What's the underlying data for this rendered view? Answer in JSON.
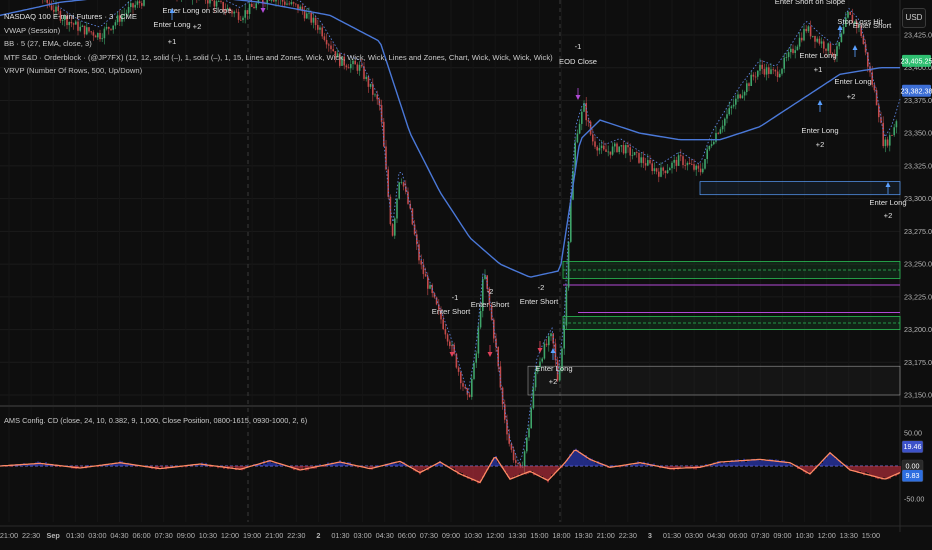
{
  "legend": {
    "symbol": "NASDAQ 100 E-mini Futures · 3 · CME",
    "lines": [
      "VWAP (Session)",
      "BB · 5 (27, EMA, close, 3)",
      "MTF S&D · Orderblock · (@JP7FX) (12, 12, solid (–), 1, solid (–), 1, 15, Lines and Zones, Wick, Wick, Wick, Wick, Lines and Zones, Chart, Wick, Wick, Wick, Wick)",
      "VRVP (Number Of Rows, 500, Up/Down)"
    ]
  },
  "currency_button": "USD",
  "price_axis": {
    "ticks": [
      "23,425.00",
      "23,400.00",
      "23,375.00",
      "23,350.00",
      "23,325.00",
      "23,300.00",
      "23,275.00",
      "23,250.00",
      "23,225.00",
      "23,200.00",
      "23,175.00",
      "23,150.00"
    ],
    "badges": [
      {
        "label": "23,405.25",
        "price": 23405.25,
        "color": "#2fbf71"
      },
      {
        "label": "23,382.38",
        "price": 23382.38,
        "color": "#3d6fd6"
      }
    ]
  },
  "oscillator": {
    "title": "AMS Config. CD (close, 24, 10, 0.382, 9, 1,000, Close Position, 0800-1615, 0930-1000, 2, 6)",
    "ticks": [
      "50.00",
      "-50.00"
    ],
    "badges": [
      {
        "label": "19.46",
        "value": 19.46,
        "color": "#3d52c9"
      },
      {
        "label": "0.00",
        "value": 0,
        "color": "#2a2a2a"
      },
      {
        "label": "9.83",
        "value": -9.83,
        "color": "#2e6fe0"
      }
    ]
  },
  "time_axis": [
    "21:00",
    "22:30",
    "Sep",
    "01:30",
    "03:00",
    "04:30",
    "06:00",
    "07:30",
    "09:00",
    "10:30",
    "12:00",
    "19:00",
    "21:00",
    "22:30",
    "2",
    "01:30",
    "03:00",
    "04:30",
    "06:00",
    "07:30",
    "09:00",
    "10:30",
    "12:00",
    "13:30",
    "15:00",
    "18:00",
    "19:30",
    "21:00",
    "22:30",
    "3",
    "01:30",
    "03:00",
    "04:30",
    "06:00",
    "07:30",
    "09:00",
    "10:30",
    "12:00",
    "13:30",
    "15:00"
  ],
  "annotations": [
    {
      "text": "Enter Long",
      "color": "#e0e0e0"
    },
    {
      "text": "+1",
      "color": "#e0e0e0"
    },
    {
      "text": "Enter Long on Slope",
      "color": "#e0e0e0"
    },
    {
      "text": "+2",
      "color": "#e0e0e0"
    },
    {
      "text": "-1",
      "color": "#e0e0e0"
    },
    {
      "text": "EOD Close",
      "color": "#e0e0e0"
    },
    {
      "text": "-1",
      "color": "#e0e0e0"
    },
    {
      "text": "Enter Short",
      "color": "#e0e0e0"
    },
    {
      "text": "-2",
      "color": "#e0e0e0"
    },
    {
      "text": "Enter Short",
      "color": "#e0e0e0"
    },
    {
      "text": "-2",
      "color": "#e0e0e0"
    },
    {
      "text": "Enter Short",
      "color": "#e0e0e0"
    },
    {
      "text": "Enter Long",
      "color": "#e0e0e0"
    },
    {
      "text": "+2",
      "color": "#e0e0e0"
    },
    {
      "text": "Enter Short on Slope",
      "color": "#e0e0e0"
    },
    {
      "text": "Enter Long",
      "color": "#e0e0e0"
    },
    {
      "text": "+1",
      "color": "#e0e0e0"
    },
    {
      "text": "Stop Loss Hit",
      "color": "#e0e0e0"
    },
    {
      "text": "Enter Short",
      "color": "#e0e0e0"
    },
    {
      "text": "Enter Long",
      "color": "#e0e0e0"
    },
    {
      "text": "+2",
      "color": "#e0e0e0"
    },
    {
      "text": "Enter Long",
      "color": "#e0e0e0"
    },
    {
      "text": "+2",
      "color": "#e0e0e0"
    },
    {
      "text": "Enter Long",
      "color": "#e0e0e0"
    },
    {
      "text": "+2",
      "color": "#e0e0e0"
    }
  ],
  "colors": {
    "up_candle": "#3fa56a",
    "down_candle": "#c44a4a",
    "vwap": "#4a78d8",
    "bb_dots": "#5d84e0",
    "zone_green": "#2bbd55",
    "zone_purple": "#b14ad6",
    "osc_red": "#c93040",
    "osc_blue": "#3040d0",
    "osc_orange": "#ff8a65"
  }
}
